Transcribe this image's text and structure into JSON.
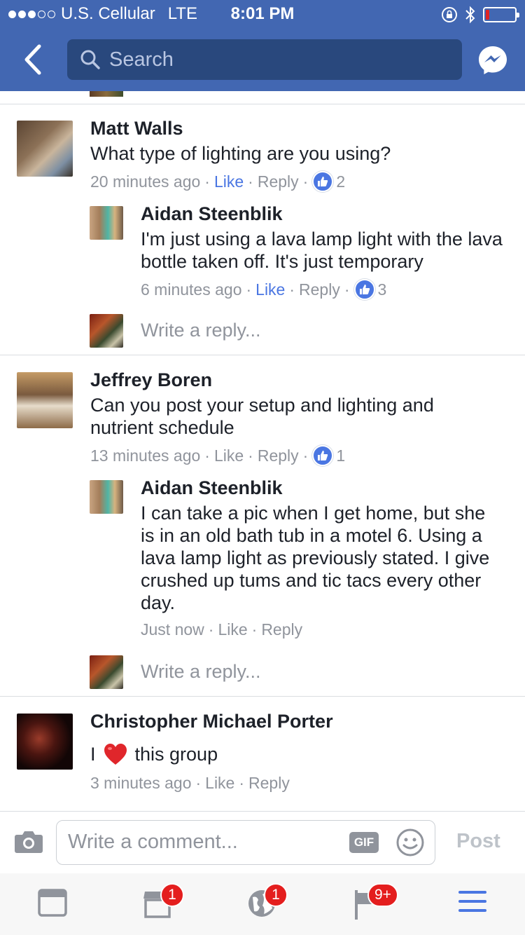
{
  "status_bar": {
    "carrier": "U.S. Cellular",
    "network": "LTE",
    "time": "8:01 PM",
    "battery_level": 0.12
  },
  "nav": {
    "search_placeholder": "Search"
  },
  "comments": [
    {
      "author": "Matt Walls",
      "text": "What type of lighting are you using?",
      "time": "20 minutes ago",
      "like_label": "Like",
      "reply_label": "Reply",
      "reaction_count": "2",
      "liked": true,
      "replies": [
        {
          "author": "Aidan Steenblik",
          "text": "I'm just using a lava lamp light with the lava bottle taken off. It's just temporary",
          "time": "6 minutes ago",
          "like_label": "Like",
          "reply_label": "Reply",
          "reaction_count": "3",
          "liked": true
        }
      ],
      "write_reply_placeholder": "Write a reply..."
    },
    {
      "author": "Jeffrey Boren",
      "text": "Can you post your setup and lighting and nutrient schedule",
      "time": "13 minutes ago",
      "like_label": "Like",
      "reply_label": "Reply",
      "reaction_count": "1",
      "liked": false,
      "replies": [
        {
          "author": "Aidan Steenblik",
          "text": "I can take a pic when I get home, but she is in an old bath tub in a motel 6. Using a lava lamp light as previously stated. I give crushed up tums and tic tacs every other day.",
          "time": "Just now",
          "like_label": "Like",
          "reply_label": "Reply"
        }
      ],
      "write_reply_placeholder": "Write a reply..."
    },
    {
      "author": "Christopher Michael Porter",
      "text_before": "I",
      "text_after": "this group",
      "time": "3 minutes ago",
      "like_label": "Like",
      "reply_label": "Reply"
    }
  ],
  "composer": {
    "placeholder": "Write a comment...",
    "gif_label": "GIF",
    "post_label": "Post"
  },
  "tabbar": {
    "marketplace_badge": "1",
    "notifications_badge": "1",
    "groups_badge": "9+"
  },
  "colors": {
    "brand_blue": "#4267b2",
    "like_blue": "#4a76e2",
    "badge_red": "#e41e1e"
  }
}
